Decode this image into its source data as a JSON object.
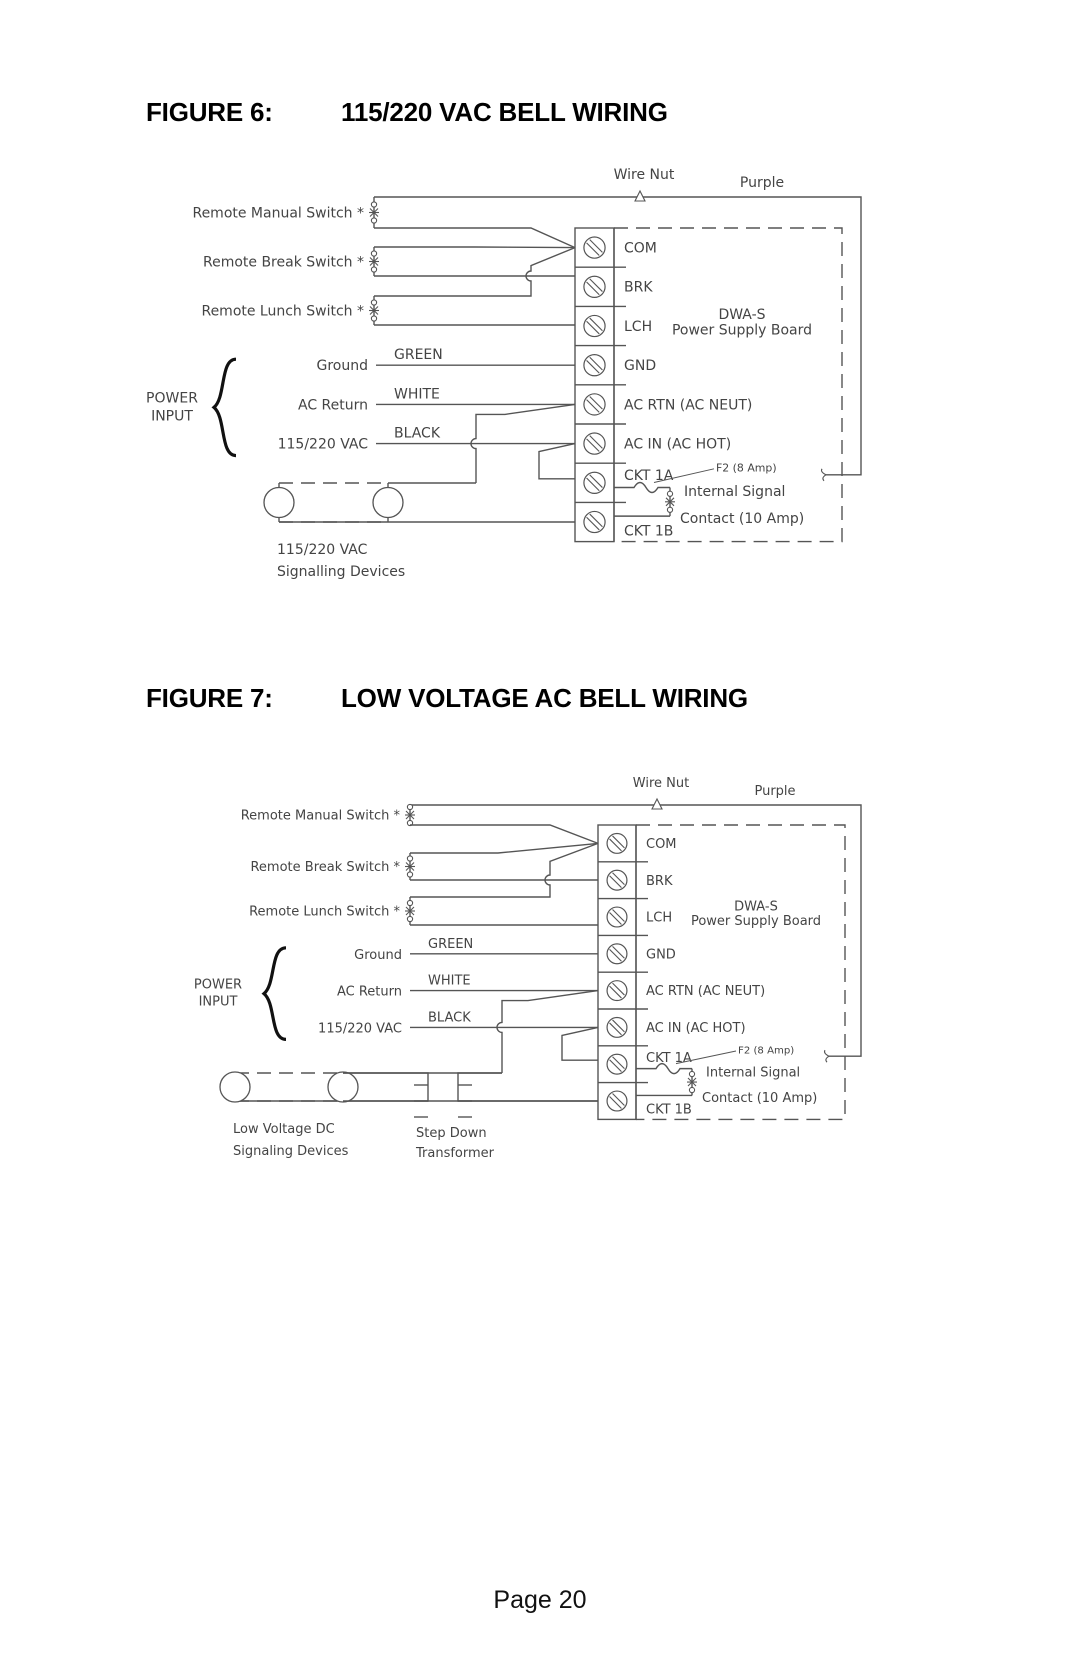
{
  "page": {
    "number_label": "Page 20"
  },
  "figures": [
    {
      "id": "fig6",
      "number": "FIGURE 6:",
      "title": "115/220 VAC BELL WIRING",
      "labels": {
        "wire_nut": "Wire Nut",
        "purple": "Purple",
        "remote_manual": "Remote Manual Switch *",
        "remote_break": "Remote Break Switch *",
        "remote_lunch": "Remote Lunch Switch *",
        "power_input_1": "POWER",
        "power_input_2": "INPUT",
        "ground": "Ground",
        "ac_return": "AC Return",
        "vac": "115/220 VAC",
        "green": "GREEN",
        "white": "WHITE",
        "black": "BLACK",
        "board_1": "DWA-S",
        "board_2": "Power Supply Board",
        "fuse": "F2 (8 Amp)",
        "internal_1": "Internal Signal",
        "internal_2": "Contact (10 Amp)",
        "devices_1": "115/220 VAC",
        "devices_2": "Signalling Devices"
      },
      "terminals": [
        "COM",
        "BRK",
        "LCH",
        "GND",
        "AC RTN (AC NEUT)",
        "AC IN (AC HOT)",
        "CKT 1A",
        "CKT 1B"
      ]
    },
    {
      "id": "fig7",
      "number": "FIGURE 7:",
      "title": "LOW VOLTAGE AC BELL WIRING",
      "labels": {
        "wire_nut": "Wire Nut",
        "purple": "Purple",
        "remote_manual": "Remote Manual Switch *",
        "remote_break": "Remote Break Switch *",
        "remote_lunch": "Remote Lunch Switch *",
        "power_input_1": "POWER",
        "power_input_2": "INPUT",
        "ground": "Ground",
        "ac_return": "AC Return",
        "vac": "115/220 VAC",
        "green": "GREEN",
        "white": "WHITE",
        "black": "BLACK",
        "board_1": "DWA-S",
        "board_2": "Power Supply Board",
        "fuse": "F2 (8 Amp)",
        "internal_1": "Internal Signal",
        "internal_2": "Contact (10 Amp)",
        "devices_1": "Low Voltage DC",
        "devices_2": "Signaling Devices",
        "transformer_1": "Step Down",
        "transformer_2": "Transformer"
      },
      "terminals": [
        "COM",
        "BRK",
        "LCH",
        "GND",
        "AC RTN (AC NEUT)",
        "AC IN (AC HOT)",
        "CKT 1A",
        "CKT 1B"
      ]
    }
  ]
}
